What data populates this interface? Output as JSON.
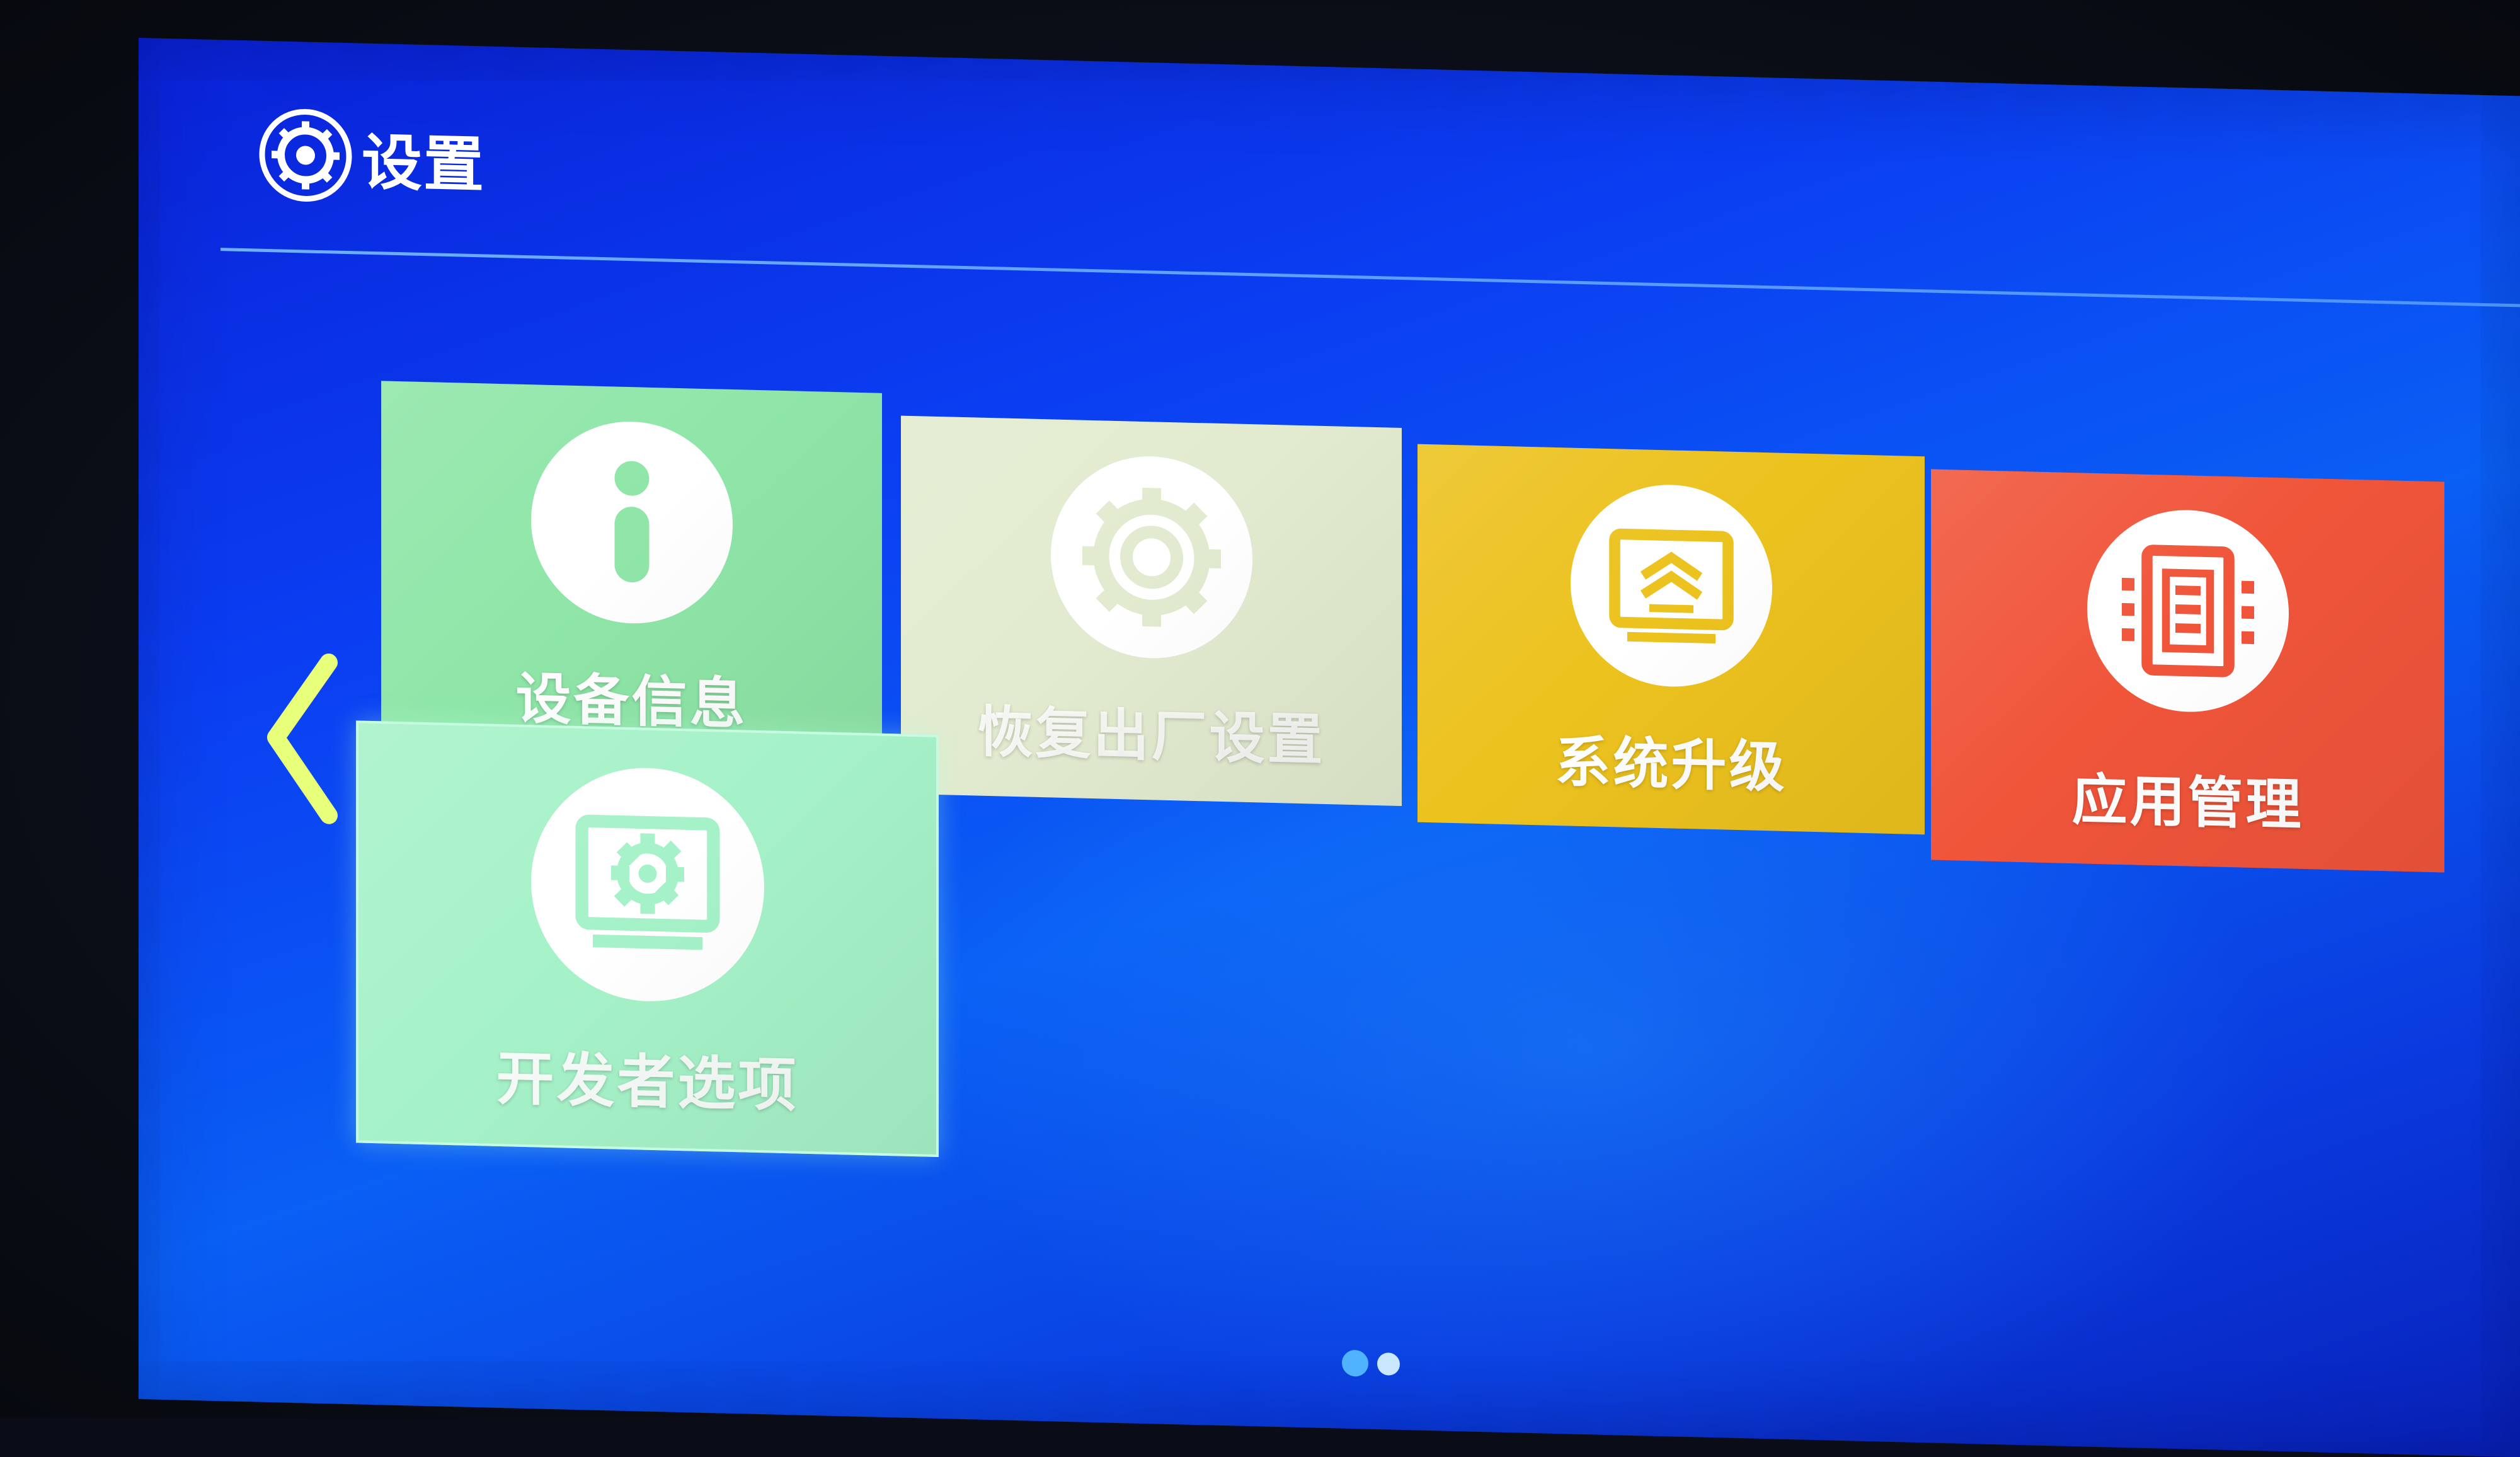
{
  "header": {
    "title": "设置",
    "icon": "settings-gear-icon"
  },
  "tiles": [
    {
      "id": "device-info",
      "label": "设备信息",
      "icon": "info-icon",
      "color": "#8fe6a8"
    },
    {
      "id": "factory-reset",
      "label": "恢复出厂设置",
      "icon": "gear-icon",
      "color": "#e2ebcf"
    },
    {
      "id": "system-upgrade",
      "label": "系统升级",
      "icon": "upgrade-icon",
      "color": "#ecc21e"
    },
    {
      "id": "app-management",
      "label": "应用管理",
      "icon": "app-management-icon",
      "color": "#f0553a"
    },
    {
      "id": "developer-options",
      "label": "开发者选项",
      "icon": "developer-options-icon",
      "color": "#a6f2c8",
      "focused": true
    }
  ],
  "navigation": {
    "prev_icon": "chevron-left-icon",
    "pages": 2,
    "current_page": 1
  },
  "colors": {
    "background": "#0b3ef2",
    "accent": "#4fb3ff"
  }
}
